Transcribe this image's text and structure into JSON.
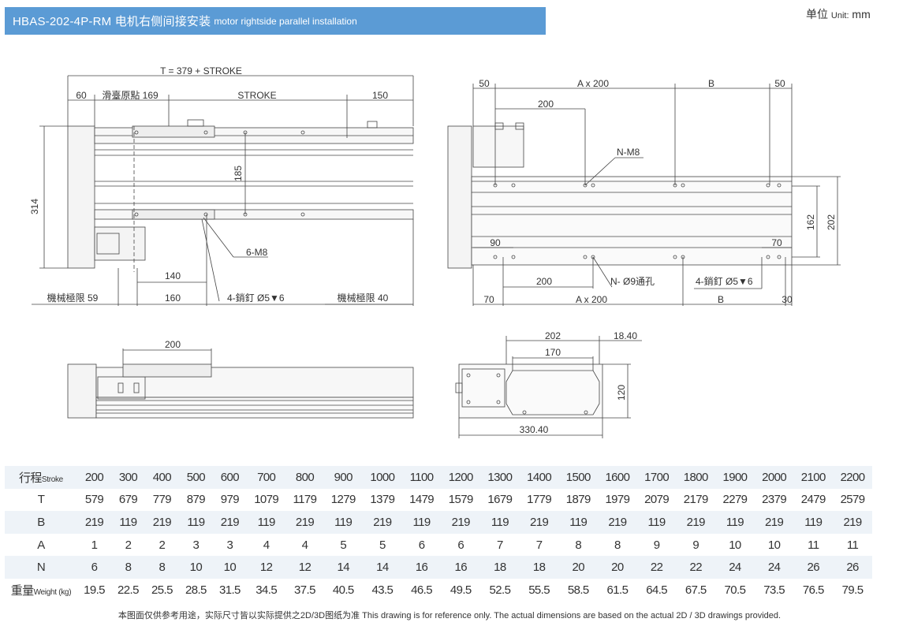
{
  "header": {
    "title_main": "HBAS-202-4P-RM 电机右侧间接安装",
    "title_sub": "motor rightside parallel installation",
    "unit_label": "单位",
    "unit_small": "Unit:",
    "unit_value": "mm"
  },
  "drawing_labels": {
    "top_T": "T = 379 + STROKE",
    "top_60": "60",
    "top_origin": "滑臺原點 169",
    "top_stroke": "STROKE",
    "top_150": "150",
    "left_314": "314",
    "mid_185": "185",
    "lbl_6m8": "6-M8",
    "lbl_140": "140",
    "lbl_160": "160",
    "lbl_pins": "4-銷釘 Ø5",
    "lbl_pins_depth": "6",
    "lbl_limit59": "機械極限 59",
    "lbl_limit40": "機械極限 40",
    "r_50a": "50",
    "r_ax200_top": "A x 200",
    "r_B_top": "B",
    "r_50b": "50",
    "r_200_top": "200",
    "r_nm8": "N-M8",
    "r_162": "162",
    "r_202v": "202",
    "r_90": "90",
    "r_70a": "70",
    "r_200_bot": "200",
    "r_n9": "N- Ø9通孔",
    "r_pins": "4-銷釘 Ø5",
    "r_pins_depth": "6",
    "r_70b": "70",
    "r_ax200_bot": "A x 200",
    "r_B_bot": "B",
    "r_30": "30",
    "side_200": "200",
    "end_202": "202",
    "end_1840": "18.40",
    "end_170": "170",
    "end_120": "120",
    "end_33040": "330.40"
  },
  "table": {
    "rows": [
      {
        "label": "行程",
        "label_small": "Stroke",
        "values": [
          "200",
          "300",
          "400",
          "500",
          "600",
          "700",
          "800",
          "900",
          "1000",
          "1100",
          "1200",
          "1300",
          "1400",
          "1500",
          "1600",
          "1700",
          "1800",
          "1900",
          "2000",
          "2100",
          "2200"
        ]
      },
      {
        "label": "T",
        "label_small": "",
        "values": [
          "579",
          "679",
          "779",
          "879",
          "979",
          "1079",
          "1179",
          "1279",
          "1379",
          "1479",
          "1579",
          "1679",
          "1779",
          "1879",
          "1979",
          "2079",
          "2179",
          "2279",
          "2379",
          "2479",
          "2579"
        ]
      },
      {
        "label": "B",
        "label_small": "",
        "values": [
          "219",
          "119",
          "219",
          "119",
          "219",
          "119",
          "219",
          "119",
          "219",
          "119",
          "219",
          "119",
          "219",
          "119",
          "219",
          "119",
          "219",
          "119",
          "219",
          "119",
          "219"
        ]
      },
      {
        "label": "A",
        "label_small": "",
        "values": [
          "1",
          "2",
          "2",
          "3",
          "3",
          "4",
          "4",
          "5",
          "5",
          "6",
          "6",
          "7",
          "7",
          "8",
          "8",
          "9",
          "9",
          "10",
          "10",
          "11",
          "11"
        ]
      },
      {
        "label": "N",
        "label_small": "",
        "values": [
          "6",
          "8",
          "8",
          "10",
          "10",
          "12",
          "12",
          "14",
          "14",
          "16",
          "16",
          "18",
          "18",
          "20",
          "20",
          "22",
          "22",
          "24",
          "24",
          "26",
          "26"
        ]
      },
      {
        "label": "重量",
        "label_small": "Weight (kg)",
        "values": [
          "19.5",
          "22.5",
          "25.5",
          "28.5",
          "31.5",
          "34.5",
          "37.5",
          "40.5",
          "43.5",
          "46.5",
          "49.5",
          "52.5",
          "55.5",
          "58.5",
          "61.5",
          "64.5",
          "67.5",
          "70.5",
          "73.5",
          "76.5",
          "79.5"
        ]
      }
    ]
  },
  "footer": {
    "note": "本图面仅供参考用途，实际尺寸皆以实际提供之2D/3D图纸为准 This drawing is for reference only. The actual dimensions are based on the actual 2D / 3D drawings provided."
  }
}
